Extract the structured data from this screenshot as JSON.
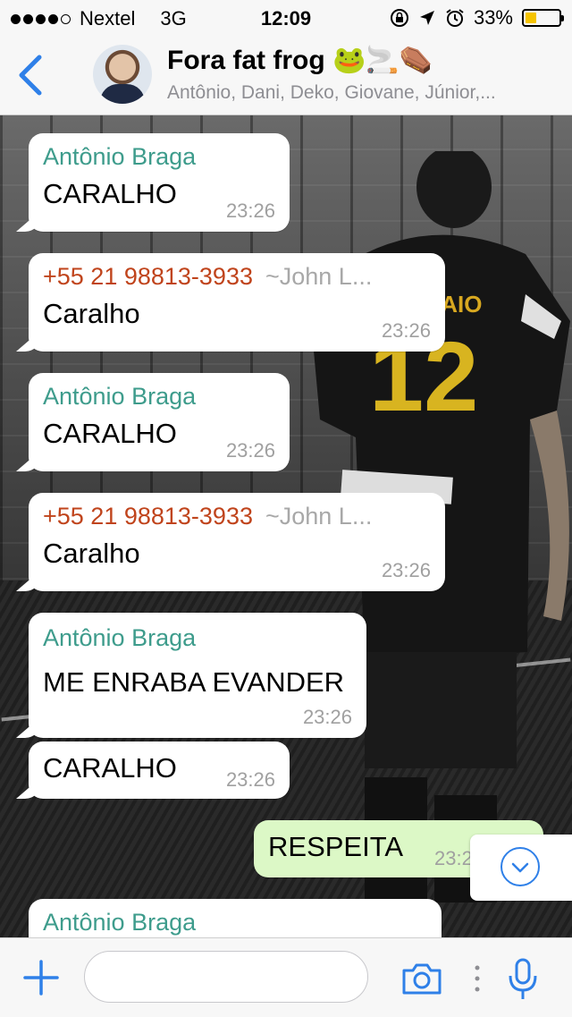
{
  "status_bar": {
    "carrier": "Nextel",
    "network": "3G",
    "time": "12:09",
    "battery_percent": "33%",
    "battery_level": 0.33,
    "signal_bars_filled": 4,
    "signal_bars_total": 5
  },
  "header": {
    "title": "Fora fat frog 🐸🚬⚰️",
    "subtitle": "Antônio, Dani, Deko, Giovane, Júnior,..."
  },
  "messages": [
    {
      "direction": "in",
      "sender": "Antônio Braga",
      "sender_color": "teal",
      "text": "CARALHO",
      "time": "23:26"
    },
    {
      "direction": "in",
      "sender": "+55 21 98813-3933",
      "alias": "~John L...",
      "sender_color": "red",
      "text": "Caralho",
      "time": "23:26"
    },
    {
      "direction": "in",
      "sender": "Antônio Braga",
      "sender_color": "teal",
      "text": "CARALHO",
      "time": "23:26"
    },
    {
      "direction": "in",
      "sender": "+55 21 98813-3933",
      "alias": "~John L...",
      "sender_color": "red",
      "text": "Caralho",
      "time": "23:26"
    },
    {
      "direction": "in",
      "sender": "Antônio Braga",
      "sender_color": "teal",
      "text": "ME ENRABA EVANDER",
      "time": "23:26"
    },
    {
      "direction": "in",
      "sender": "",
      "sender_color": "teal",
      "text": "CARALHO",
      "time": "23:26"
    },
    {
      "direction": "out",
      "sender": "",
      "text": "RESPEITA",
      "time": "23:26"
    },
    {
      "direction": "in",
      "sender": "Antônio Braga",
      "sender_color": "teal",
      "text": "",
      "time": ""
    }
  ],
  "input": {
    "value": "",
    "placeholder": ""
  },
  "colors": {
    "accent": "#2f80e8",
    "teal_sender": "#3e9c8c",
    "red_sender": "#c0441c",
    "outgoing_bubble": "#dcf8c6",
    "battery": "#f5c400"
  },
  "icons": {
    "back": "chevron-left-icon",
    "plus": "plus-icon",
    "camera": "camera-icon",
    "mic": "microphone-icon",
    "scroll": "chevron-down-icon"
  }
}
